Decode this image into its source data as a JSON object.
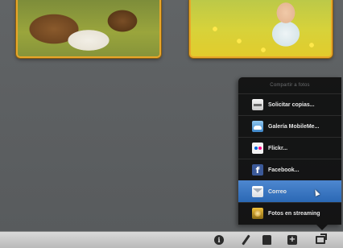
{
  "share_menu": {
    "title": "Compartir a fotos",
    "items": [
      {
        "label": "Solicitar copias...",
        "icon": "printer-icon"
      },
      {
        "label": "Galería MobileMe...",
        "icon": "mobileme-cloud-icon"
      },
      {
        "label": "Flickr...",
        "icon": "flickr-icon"
      },
      {
        "label": "Facebook...",
        "icon": "facebook-icon",
        "glyph": "f"
      },
      {
        "label": "Correo",
        "icon": "mail-icon",
        "selected": true
      },
      {
        "label": "Fotos en streaming",
        "icon": "photo-stream-icon"
      }
    ]
  },
  "toolbar": {
    "info_glyph": "i",
    "add_glyph": "+",
    "buttons": [
      "info-icon",
      "edit-icon",
      "effects-icon",
      "add-icon",
      "share-icon"
    ]
  },
  "colors": {
    "background": "#5b5e60",
    "photo_border": "#e8a62a",
    "menu_background": "#121212",
    "selection": "#2b68b5",
    "toolbar": "#c9c9c9"
  }
}
